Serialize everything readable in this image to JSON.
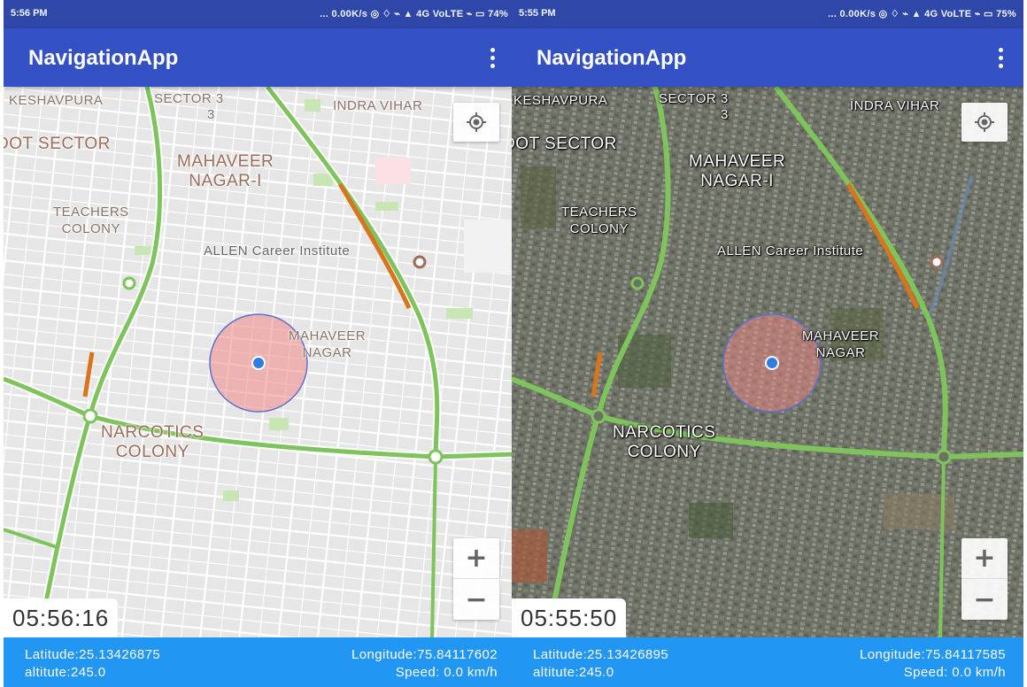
{
  "screens": [
    {
      "status_bar": {
        "time": "5:56 PM",
        "stats": "... 0.00K/s ◎ ♢ ⌁ ▲ 4G VoLTE ⌁ ▭ 74%"
      },
      "app_bar": {
        "title": "NavigationApp"
      },
      "map": {
        "type": "street",
        "labels": {
          "keshavpura": "KESHAVPURA",
          "sector3": "SECTOR 3",
          "sector3b": "3",
          "indra_vihar": "INDRA VIHAR",
          "dot_sector": "DOT SECTOR",
          "mahaveer_nagar_1": "MAHAVEER\nNAGAR-I",
          "teachers_colony": "TEACHERS\nCOLONY",
          "allen": "ALLEN Career Institute",
          "mahaveer_nagar": "MAHAVEER\nNAGAR",
          "narcotics_colony": "NARCOTICS\nCOLONY"
        },
        "zoom_in": "+",
        "zoom_out": "−",
        "clock": "05:56:16"
      },
      "info": {
        "latitude": "Latitude:25.13426875",
        "longitude": "Longitude:75.84117602",
        "altitude": "altitute:245.0",
        "speed": "Speed: 0.0 km/h"
      }
    },
    {
      "status_bar": {
        "time": "5:55 PM",
        "stats": "... 0.00K/s ◎ ♢ ⌁ ▲ 4G VoLTE ⌁ ▭ 75%"
      },
      "app_bar": {
        "title": "NavigationApp"
      },
      "map": {
        "type": "satellite",
        "labels": {
          "keshavpura": "KESHAVPURA",
          "sector3": "SECTOR 3",
          "sector3b": "3",
          "indra_vihar": "INDRA VIHAR",
          "dot_sector": "DOT SECTOR",
          "mahaveer_nagar_1": "MAHAVEER\nNAGAR-I",
          "teachers_colony": "TEACHERS\nCOLONY",
          "allen": "ALLEN Career Institute",
          "mahaveer_nagar": "MAHAVEER\nNAGAR",
          "narcotics_colony": "NARCOTICS\nCOLONY"
        },
        "zoom_in": "+",
        "zoom_out": "−",
        "clock": "05:55:50"
      },
      "info": {
        "latitude": "Latitude:25.13426895",
        "longitude": "Longitude:75.84117585",
        "altitude": "altitute:245.0",
        "speed": "Speed: 0.0 km/h"
      }
    }
  ],
  "colors": {
    "status_bar": "#2e47a8",
    "app_bar": "#3451c4",
    "info_panel": "#2196f3",
    "road_major": "#7ec35c",
    "traffic_slow": "#d9731c",
    "accuracy_circle": "#f08585",
    "location_dot": "#2f7de1"
  },
  "icons": {
    "menu": "overflow-menu-icon",
    "my_location": "my-location-icon",
    "poi": "poi-marker-icon"
  }
}
